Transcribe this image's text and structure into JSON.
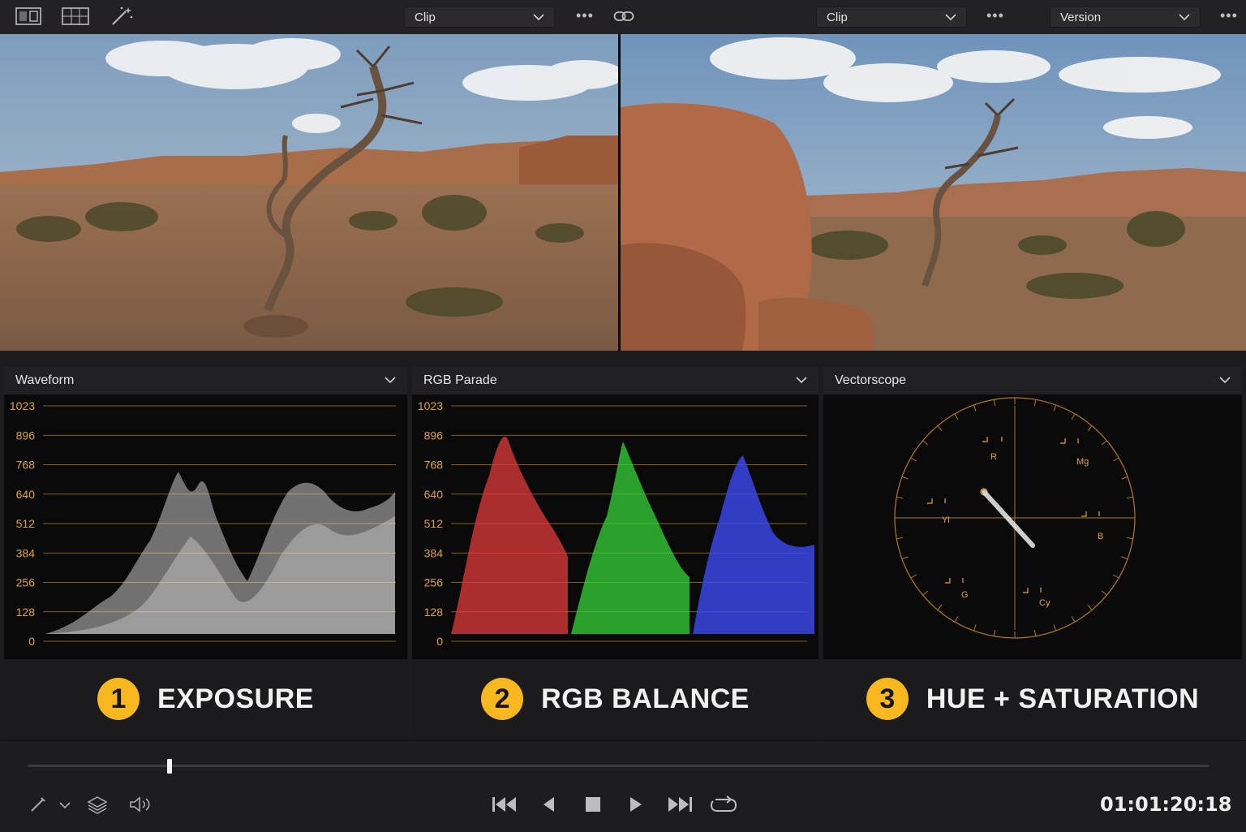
{
  "toolbar": {
    "icons": [
      "viewer-layout-icon",
      "grid-layout-icon",
      "magic-wand-icon"
    ],
    "left_dropdown": "Clip",
    "right_dropdown": "Clip",
    "version_dropdown": "Version",
    "more": "•••"
  },
  "scopes": [
    {
      "title": "Waveform",
      "scale": [
        "1023",
        "896",
        "768",
        "640",
        "512",
        "384",
        "256",
        "128",
        "0"
      ],
      "badge": "1",
      "caption": "EXPOSURE"
    },
    {
      "title": "RGB Parade",
      "scale": [
        "1023",
        "896",
        "768",
        "640",
        "512",
        "384",
        "256",
        "128",
        "0"
      ],
      "badge": "2",
      "caption": "RGB BALANCE"
    },
    {
      "title": "Vectorscope",
      "targets": [
        "R",
        "Mg",
        "B",
        "Cy",
        "G",
        "Yl"
      ],
      "badge": "3",
      "caption": "HUE + SATURATION"
    }
  ],
  "transport": {
    "timecode": "01:01:20:18",
    "playhead_position": 0.12
  },
  "colors": {
    "accent": "#f6b71f",
    "scope_grid": "#b07a1a",
    "red_channel": "#e23b3b",
    "green_channel": "#35d43a",
    "blue_channel": "#3b4af0"
  }
}
